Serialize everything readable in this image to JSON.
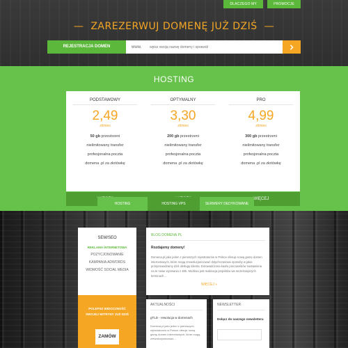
{
  "topnav": {
    "item1": "DLACZEGO MY",
    "item2": "PROMOCJE"
  },
  "header": {
    "headline": "ZAREZERWUJ DOMENĘ JUŻ DZIŚ",
    "domain_label": "REJESTRACJA DOMEN",
    "www_prefix": "www.",
    "domain_placeholder": "wpisz swoją nazwę domeny i sprawdź"
  },
  "hosting": {
    "title": "HOSTING",
    "plans": [
      {
        "name": "PODSTAWOWY",
        "price": "2,49",
        "per": "zł/mies",
        "storage": "50 gb",
        "storage_text": " przestrzeni",
        "f2": "nielimitowany transfer",
        "f3": "profesjonalna poczta",
        "f4": "domena .pl za złotówkę",
        "more": "WIĘCEJ"
      },
      {
        "name": "OPTYMALNY",
        "price": "3,30",
        "per": "zł/mies",
        "storage": "200 gb",
        "storage_text": " przestrzeni",
        "f2": "nielimitowany transfer",
        "f3": "profesjonalna poczta",
        "f4": "domena .pl za złotówkę",
        "more": "WIĘCEJ"
      },
      {
        "name": "PRO",
        "price": "4,99",
        "per": "zł/mies",
        "storage": "300 gb",
        "storage_text": " przestrzeni",
        "f2": "nielimitowany transfer",
        "f3": "profesjonalna poczta",
        "f4": "domena .pl za złotówkę",
        "more": "WIĘCEJ"
      }
    ],
    "tabs": [
      "HOSTING",
      "HOSTING VPS",
      "SERWERY DEDYKOWANE"
    ]
  },
  "semseo": {
    "title": "SEM/SEO",
    "subtitle": "REKLAMA INTERNETOWA",
    "items": [
      "POZYCJONOWANIE",
      "KAMPANIA ADWORDS",
      "WIDMOŚĆ SOCIAL MEDIA"
    ],
    "promo_text_1": "POLEPSZ WIDOCZNOŚĆ",
    "promo_text_2": "SWOJEJ WITRYNY JUŻ DZIŚ",
    "promo_button": "ZAMÓW"
  },
  "blog": {
    "title": "BLOG DOMENA.PL",
    "subtitle": "Rozdajemy domeny!",
    "text": "Domena.pl jako jeden z pierwszych rejestratorów w Polsce oferuje nową gamę domen internetowych, które mogą zrewolucjonizować dotychczasowe sposoby w jakie przeprowadzamy dziś obsługę klienta. Dotowadczona kadra pracowników nastawiona na te nowe wyzwania z 48h. Możliwa jest realizacja projektów we wcześniejszych terminach...",
    "more": "WIĘCEJ »"
  },
  "news": {
    "title": "AKTUALNOŚCI",
    "subtitle": "gTLD - rewolucja w domenach",
    "text": "Domena.pl jako jeden z pierwszych rejestratorów w Polsce oferuje nową gamę domen internetowych, które mogą zrewolucjonizować..."
  },
  "newsletter": {
    "title": "NEWSLETTER",
    "subtitle": "Dołącz do naszego newslettera"
  },
  "colors": {
    "green": "#66c24a",
    "dark_green": "#4e9e32",
    "orange": "#f5a623",
    "dark": "#2e2e2e"
  }
}
